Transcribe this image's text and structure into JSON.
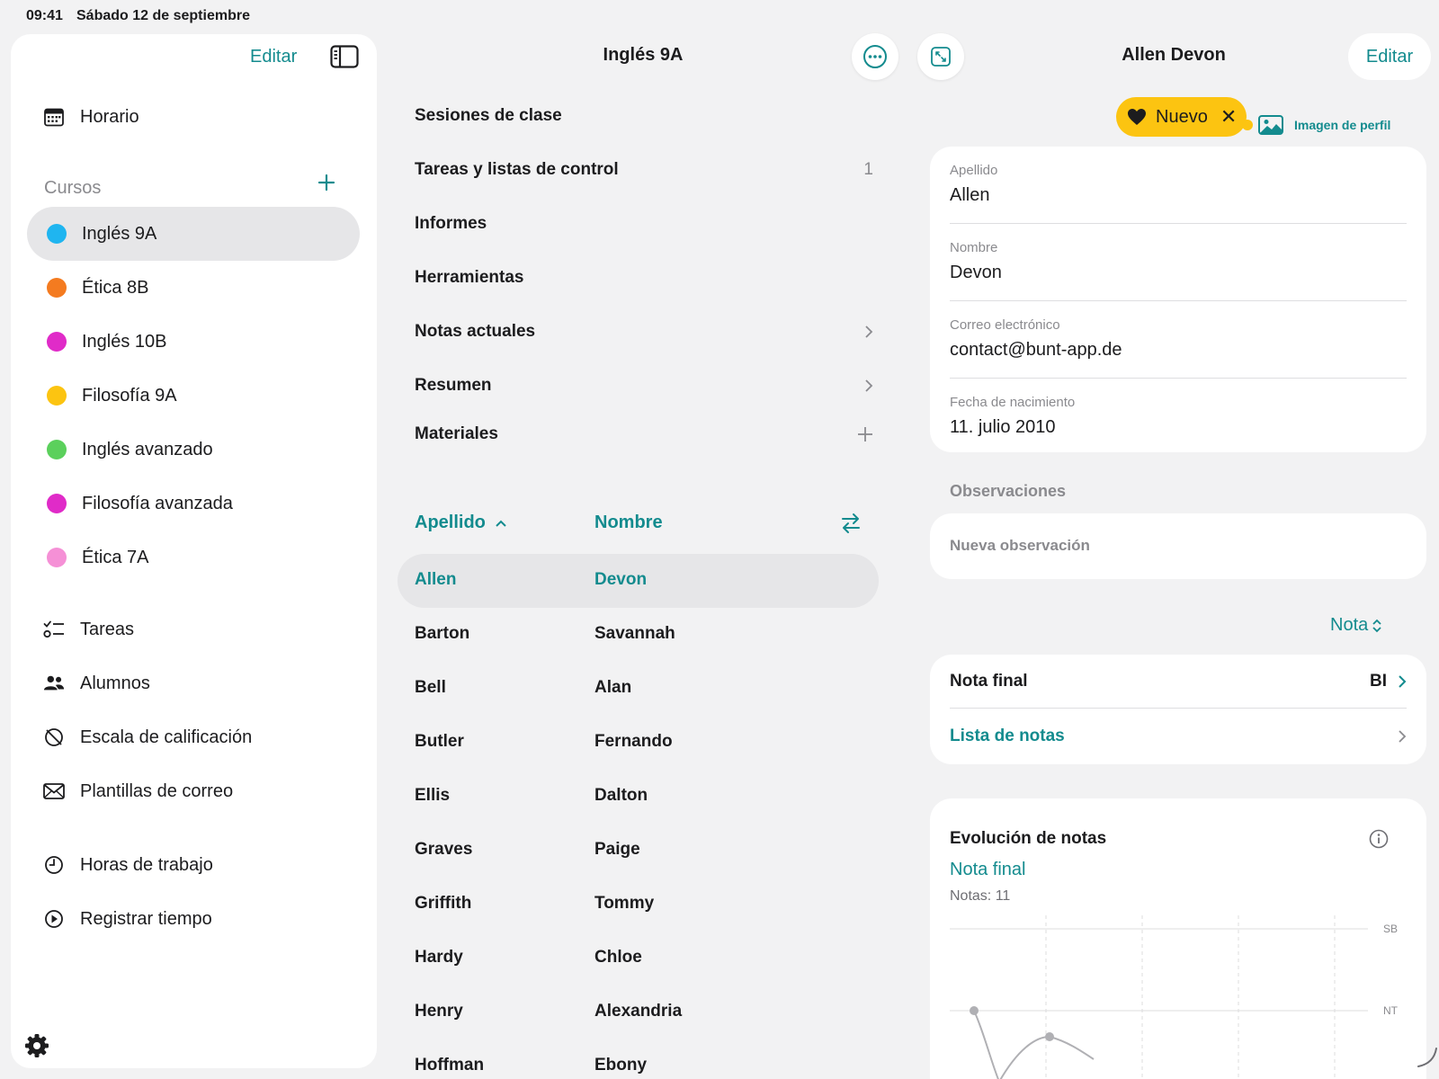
{
  "status": {
    "time": "09:41",
    "date": "Sábado 12 de septiembre",
    "icons": [
      "signal-icon",
      "wifi-icon",
      "battery-icon"
    ]
  },
  "sidebar": {
    "edit_label": "Editar",
    "schedule_label": "Horario",
    "courses_label": "Cursos",
    "courses": [
      {
        "label": "Inglés 9A",
        "color": "#1fb5f0",
        "selected": true
      },
      {
        "label": "Ética 8B",
        "color": "#f47b20"
      },
      {
        "label": "Inglés 10B",
        "color": "#e02bc8"
      },
      {
        "label": "Filosofía 9A",
        "color": "#fcc411"
      },
      {
        "label": "Inglés avanzado",
        "color": "#5bd05c"
      },
      {
        "label": "Filosofía avanzada",
        "color": "#e02bc8"
      },
      {
        "label": "Ética 7A",
        "color": "#f590d6"
      }
    ],
    "tools": [
      {
        "label": "Tareas",
        "icon": "checklist-icon"
      },
      {
        "label": "Alumnos",
        "icon": "people-icon"
      },
      {
        "label": "Escala de calificación",
        "icon": "grading-scale-icon"
      },
      {
        "label": "Plantillas de correo",
        "icon": "envelope-icon"
      }
    ],
    "time_items": [
      {
        "label": "Horas de trabajo",
        "icon": "clock-icon"
      },
      {
        "label": "Registrar tiempo",
        "icon": "play-circle-icon"
      }
    ]
  },
  "course": {
    "title": "Inglés 9A",
    "menu": [
      {
        "label": "Sesiones de clase",
        "right": ""
      },
      {
        "label": "Tareas y listas de control",
        "right": "1"
      },
      {
        "label": "Informes",
        "right": ""
      },
      {
        "label": "Herramientas",
        "right": ""
      },
      {
        "label": "Notas actuales",
        "right": "chevron"
      },
      {
        "label": "Resumen",
        "right": "chevron"
      },
      {
        "label": "Materiales",
        "right": "plus"
      }
    ],
    "sort": {
      "lastname_label": "Apellido",
      "firstname_label": "Nombre"
    },
    "students": [
      {
        "last": "Allen",
        "first": "Devon",
        "selected": true
      },
      {
        "last": "Barton",
        "first": "Savannah"
      },
      {
        "last": "Bell",
        "first": "Alan"
      },
      {
        "last": "Butler",
        "first": "Fernando"
      },
      {
        "last": "Ellis",
        "first": "Dalton"
      },
      {
        "last": "Graves",
        "first": "Paige"
      },
      {
        "last": "Griffith",
        "first": "Tommy"
      },
      {
        "last": "Hardy",
        "first": "Chloe"
      },
      {
        "last": "Henry",
        "first": "Alexandria"
      },
      {
        "last": "Hoffman",
        "first": "Ebony"
      }
    ]
  },
  "detail": {
    "title": "Allen Devon",
    "edit_label": "Editar",
    "badge_label": "Nuevo",
    "profile_image_label": "Imagen de perfil",
    "fields": {
      "lastname_label": "Apellido",
      "lastname": "Allen",
      "firstname_label": "Nombre",
      "firstname": "Devon",
      "email_label": "Correo electrónico",
      "email": "contact@bunt-app.de",
      "birth_label": "Fecha de nacimiento",
      "birth": "11. julio 2010"
    },
    "observations_label": "Observaciones",
    "new_observation_label": "Nueva observación",
    "grade_selector": "Nota",
    "final_grade_label": "Nota final",
    "final_grade_value": "BI",
    "grade_list_label": "Lista de notas",
    "evolution": {
      "title": "Evolución de notas",
      "subtitle": "Nota final",
      "count": "Notas: 11"
    }
  },
  "chart_data": {
    "type": "line",
    "y_levels": [
      "SB",
      "NT"
    ],
    "points": [
      {
        "level": "NT"
      },
      {
        "level": "below NT"
      },
      {
        "level": "near NT"
      }
    ]
  },
  "colors": {
    "accent": "#138b8e",
    "badge": "#fcc411",
    "selected_row": "#e6e6e8"
  }
}
